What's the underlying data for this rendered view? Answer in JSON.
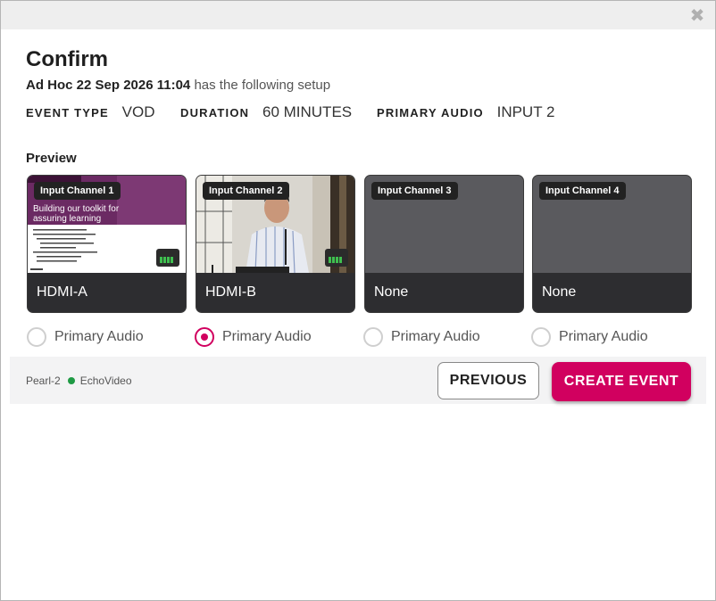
{
  "dialog": {
    "title": "Confirm",
    "subtitle_bold": "Ad Hoc 22 Sep 2026 11:04",
    "subtitle_rest": "has the following setup"
  },
  "meta": {
    "event_type_label": "EVENT TYPE",
    "event_type_value": "VOD",
    "duration_label": "DURATION",
    "duration_value": "60 MINUTES",
    "primary_audio_label": "PRIMARY AUDIO",
    "primary_audio_value": "INPUT 2"
  },
  "preview": {
    "label": "Preview",
    "channels": [
      {
        "tag": "Input Channel 1",
        "source": "HDMI-A",
        "has_video": true,
        "slide_title": "Building our toolkit for assuring learning"
      },
      {
        "tag": "Input Channel 2",
        "source": "HDMI-B",
        "has_video": true
      },
      {
        "tag": "Input Channel 3",
        "source": "None",
        "has_video": false
      },
      {
        "tag": "Input Channel 4",
        "source": "None",
        "has_video": false
      }
    ],
    "audio_option_label": "Primary Audio",
    "selected_audio_index": 1
  },
  "footer": {
    "device_name": "Pearl-2",
    "status_color": "#1f9a44",
    "service": "EchoVideo",
    "previous_label": "PREVIOUS",
    "create_label": "CREATE EVENT"
  },
  "colors": {
    "accent": "#d1005f"
  }
}
